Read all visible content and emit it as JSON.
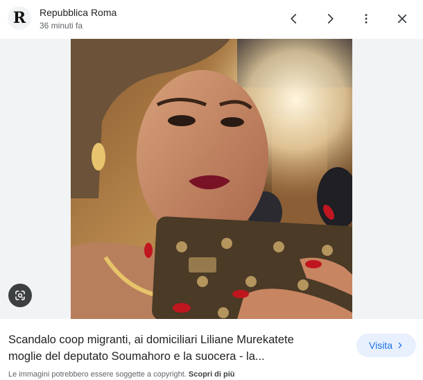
{
  "header": {
    "logo_letter": "R",
    "source_name": "Repubblica Roma",
    "time": "36 minuti fa",
    "icons": [
      "chevron-left-icon",
      "chevron-right-icon",
      "more-vert-icon",
      "close-icon"
    ]
  },
  "image": {
    "lens_icon": "google-lens-icon"
  },
  "article": {
    "headline_line1": "Scandalo coop migranti, ai domiciliari Liliane Murekatete",
    "headline_line2": "moglie del deputato Soumahoro e la suocera - la..."
  },
  "visit_button": {
    "label": "Visita",
    "icon": "chevron-right-icon"
  },
  "footer": {
    "notice": "Le immagini potrebbero essere soggette a copyright.",
    "link": "Scopri di più"
  },
  "colors": {
    "accent": "#1a73e8",
    "visit_bg": "#e8f0fe",
    "image_bg": "#f1f3f4"
  }
}
